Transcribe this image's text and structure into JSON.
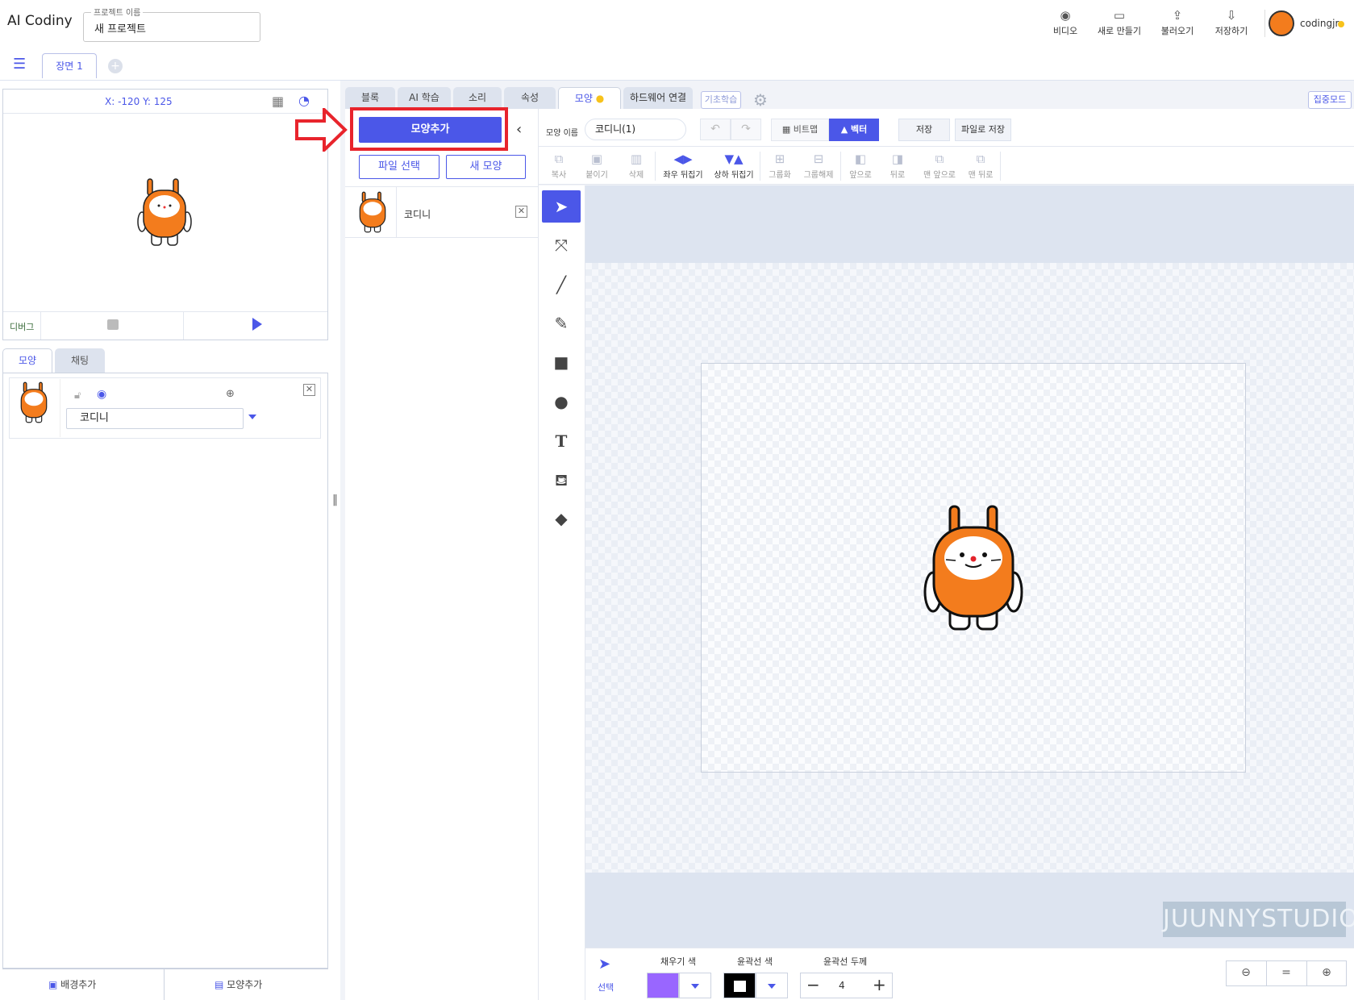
{
  "header": {
    "logo": "AI Codiny",
    "project_label": "프로젝트 이름",
    "project_name": "새 프로젝트",
    "buttons": [
      {
        "label": "비디오",
        "icon": "video-icon"
      },
      {
        "label": "새로 만들기",
        "icon": "new-file-icon"
      },
      {
        "label": "불러오기",
        "icon": "upload-icon"
      },
      {
        "label": "저장하기",
        "icon": "download-icon"
      }
    ],
    "username": "codingjr"
  },
  "scene": {
    "tab_label": "장면 1",
    "add_symbol": "+"
  },
  "stage": {
    "coords": "X: -120 Y: 125",
    "debug_label": "디버그"
  },
  "left_tabs": {
    "shape": "모양",
    "chat": "채팅"
  },
  "object": {
    "name": "코디니",
    "close_symbol": "✕"
  },
  "left_bottom": {
    "add_background": "배경추가",
    "add_shape": "모양추가"
  },
  "main_tabs": [
    {
      "label": "블록"
    },
    {
      "label": "AI 학습"
    },
    {
      "label": "소리"
    },
    {
      "label": "속성"
    },
    {
      "label": "모양"
    },
    {
      "label": "하드웨어 연결"
    }
  ],
  "basic_learning": "기초학습",
  "focus_mode": "집중모드",
  "shape_panel": {
    "add_button": "모양추가",
    "file_select": "파일 선택",
    "new_shape": "새 모양",
    "costume_name": "코디니",
    "close_symbol": "✕"
  },
  "editor": {
    "shape_name_label": "모양 이름",
    "shape_name_value": "코디니(1)",
    "bitmap_label": "비트맵",
    "vector_label": "벡터",
    "save_label": "저장",
    "save_file_label": "파일로 저장",
    "tools": [
      {
        "label": "복사",
        "enabled": false
      },
      {
        "label": "붙이기",
        "enabled": false
      },
      {
        "label": "삭제",
        "enabled": false
      },
      {
        "label": "좌우 뒤집기",
        "enabled": true
      },
      {
        "label": "상하 뒤집기",
        "enabled": true
      },
      {
        "label": "그룹화",
        "enabled": false
      },
      {
        "label": "그룹해제",
        "enabled": false
      },
      {
        "label": "앞으로",
        "enabled": false
      },
      {
        "label": "뒤로",
        "enabled": false
      },
      {
        "label": "맨 앞으로",
        "enabled": false
      },
      {
        "label": "맨 뒤로",
        "enabled": false
      }
    ]
  },
  "bottom_bar": {
    "select_label": "선택",
    "fill_label": "채우기 색",
    "stroke_label": "윤곽선 색",
    "width_label": "윤곽선 두께",
    "width_value": "4",
    "fill_color": "#9966ff",
    "stroke_color": "#000000"
  },
  "watermark": "JUUNNYSTUDIO",
  "colors": {
    "accent": "#4b57e8",
    "highlight_box": "#e8242c",
    "character": "#f37c1d"
  }
}
